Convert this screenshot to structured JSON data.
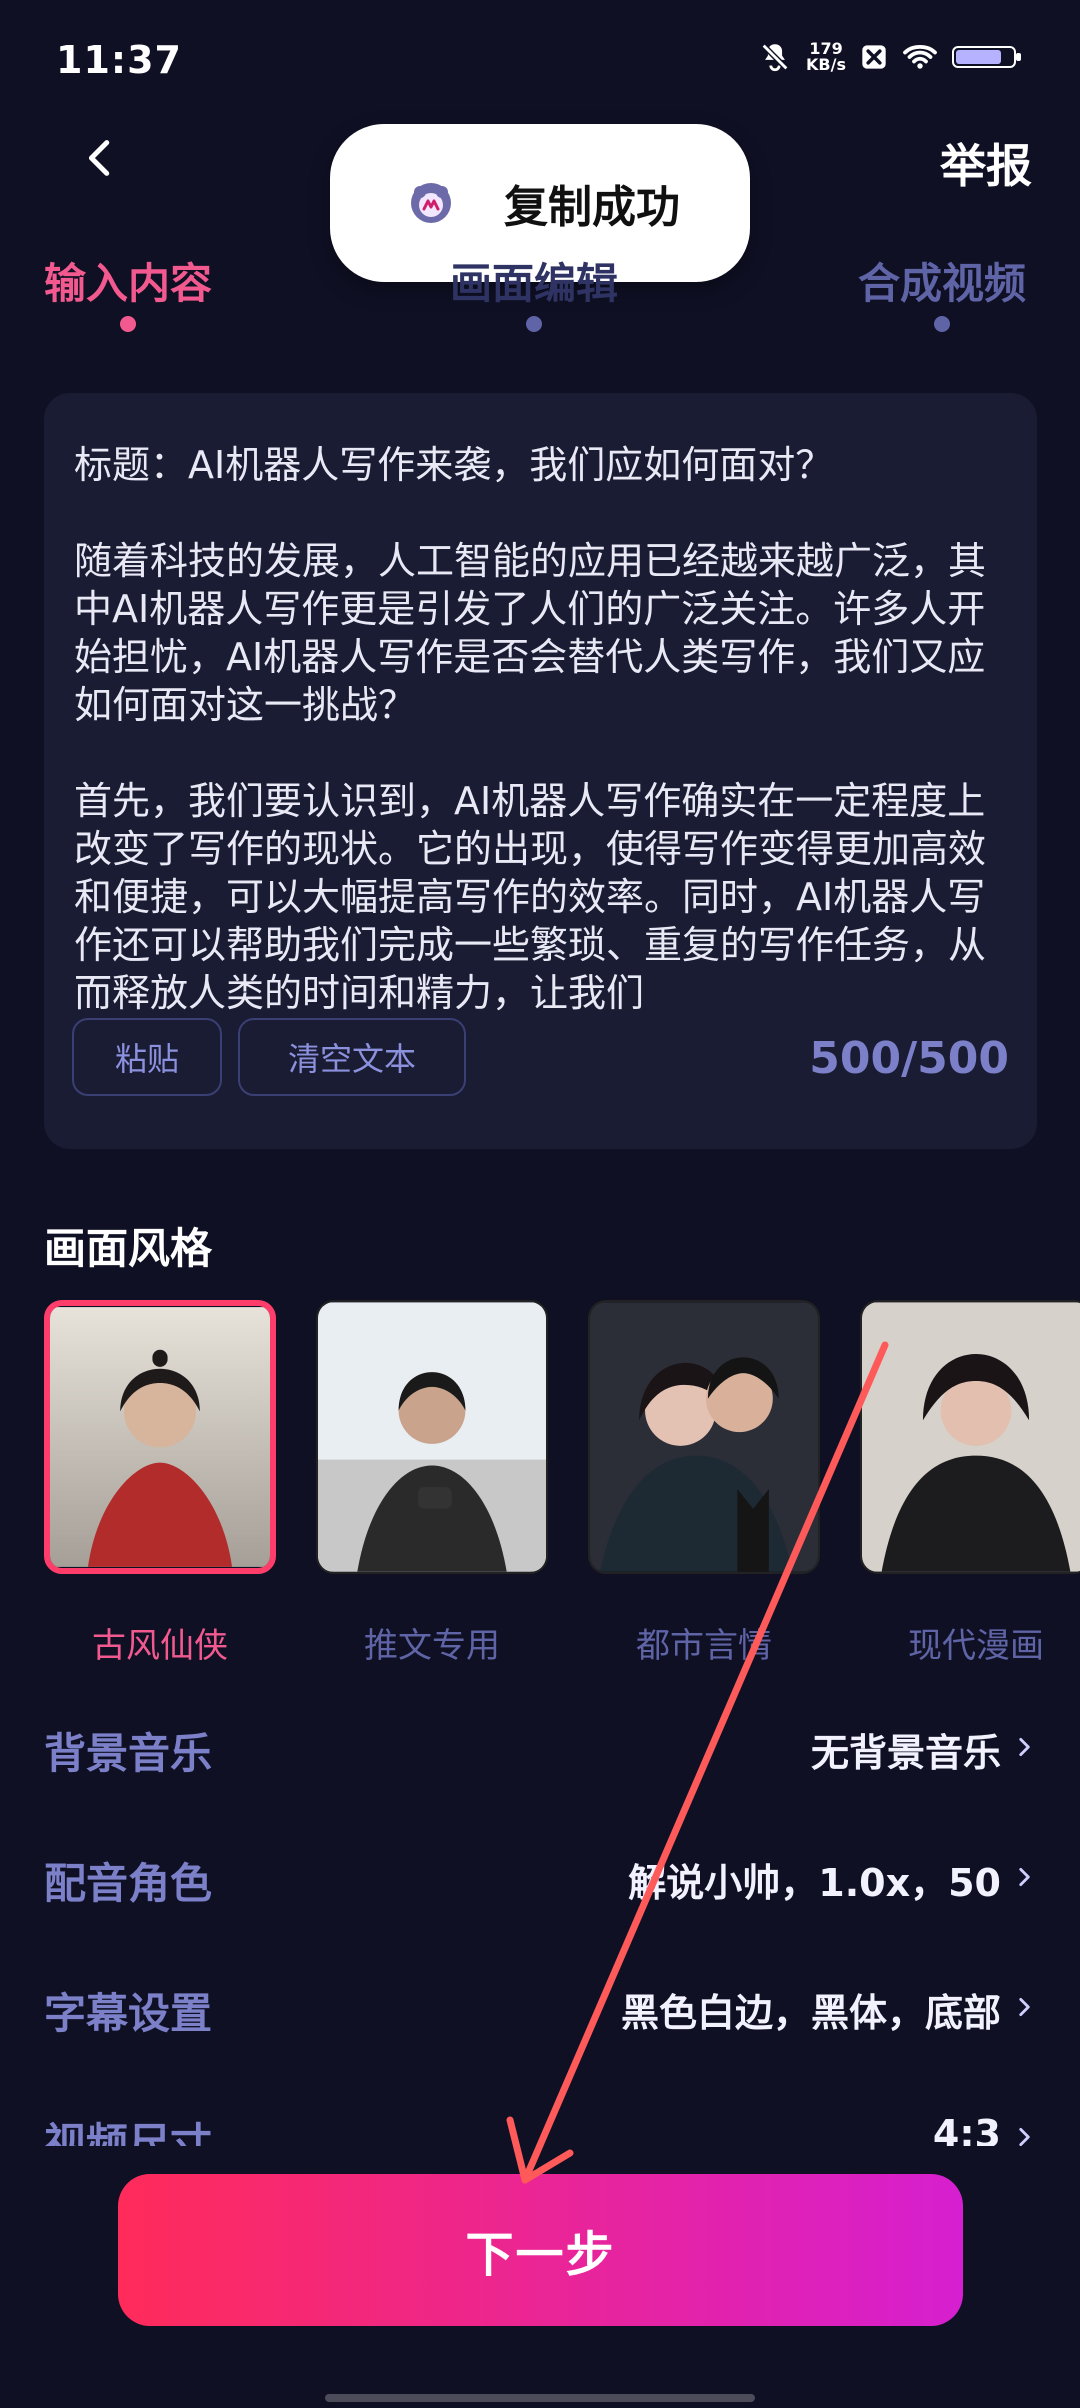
{
  "status_bar": {
    "time": "11:37",
    "net_speed_value": "179",
    "net_speed_unit": "KB/s",
    "battery_level": 0.8
  },
  "topbar": {
    "report_label": "举报"
  },
  "toast": {
    "text": "复制成功"
  },
  "steps": [
    {
      "label": "输入内容",
      "state": "active"
    },
    {
      "label": "画面编辑",
      "state": "obscured"
    },
    {
      "label": "合成视频",
      "state": "inactive"
    }
  ],
  "text_card": {
    "content": "标题：AI机器人写作来袭，我们应如何面对？\n\n随着科技的发展，人工智能的应用已经越来越广泛，其中AI机器人写作更是引发了人们的广泛关注。许多人开始担忧，AI机器人写作是否会替代人类写作，我们又应如何面对这一挑战？\n\n首先，我们要认识到，AI机器人写作确实在一定程度上改变了写作的现状。它的出现，使得写作变得更加高效和便捷，可以大幅提高写作的效率。同时，AI机器人写作还可以帮助我们完成一些繁琐、重复的写作任务，从而释放人类的时间和精力，让我们",
    "paste_label": "粘贴",
    "clear_label": "清空文本",
    "counter": "500/500"
  },
  "style_section": {
    "title": "画面风格",
    "items": [
      {
        "label": "古风仙侠",
        "selected": true
      },
      {
        "label": "推文专用",
        "selected": false
      },
      {
        "label": "都市言情",
        "selected": false
      },
      {
        "label": "现代漫画",
        "selected": false
      }
    ]
  },
  "settings": [
    {
      "key": "背景音乐",
      "value": "无背景音乐"
    },
    {
      "key": "配音角色",
      "value": "解说小帅，1.0x，50"
    },
    {
      "key": "字幕设置",
      "value": "黑色白边，黑体，底部"
    },
    {
      "key": "视频尺寸",
      "value": "4:3"
    }
  ],
  "footer": {
    "next_label": "下一步"
  },
  "colors": {
    "accent_pink": "#f25a8f",
    "button_gradient_start": "#ff2b5a",
    "button_gradient_end": "#d61fd0",
    "annotation_arrow": "#ff5a5a"
  }
}
